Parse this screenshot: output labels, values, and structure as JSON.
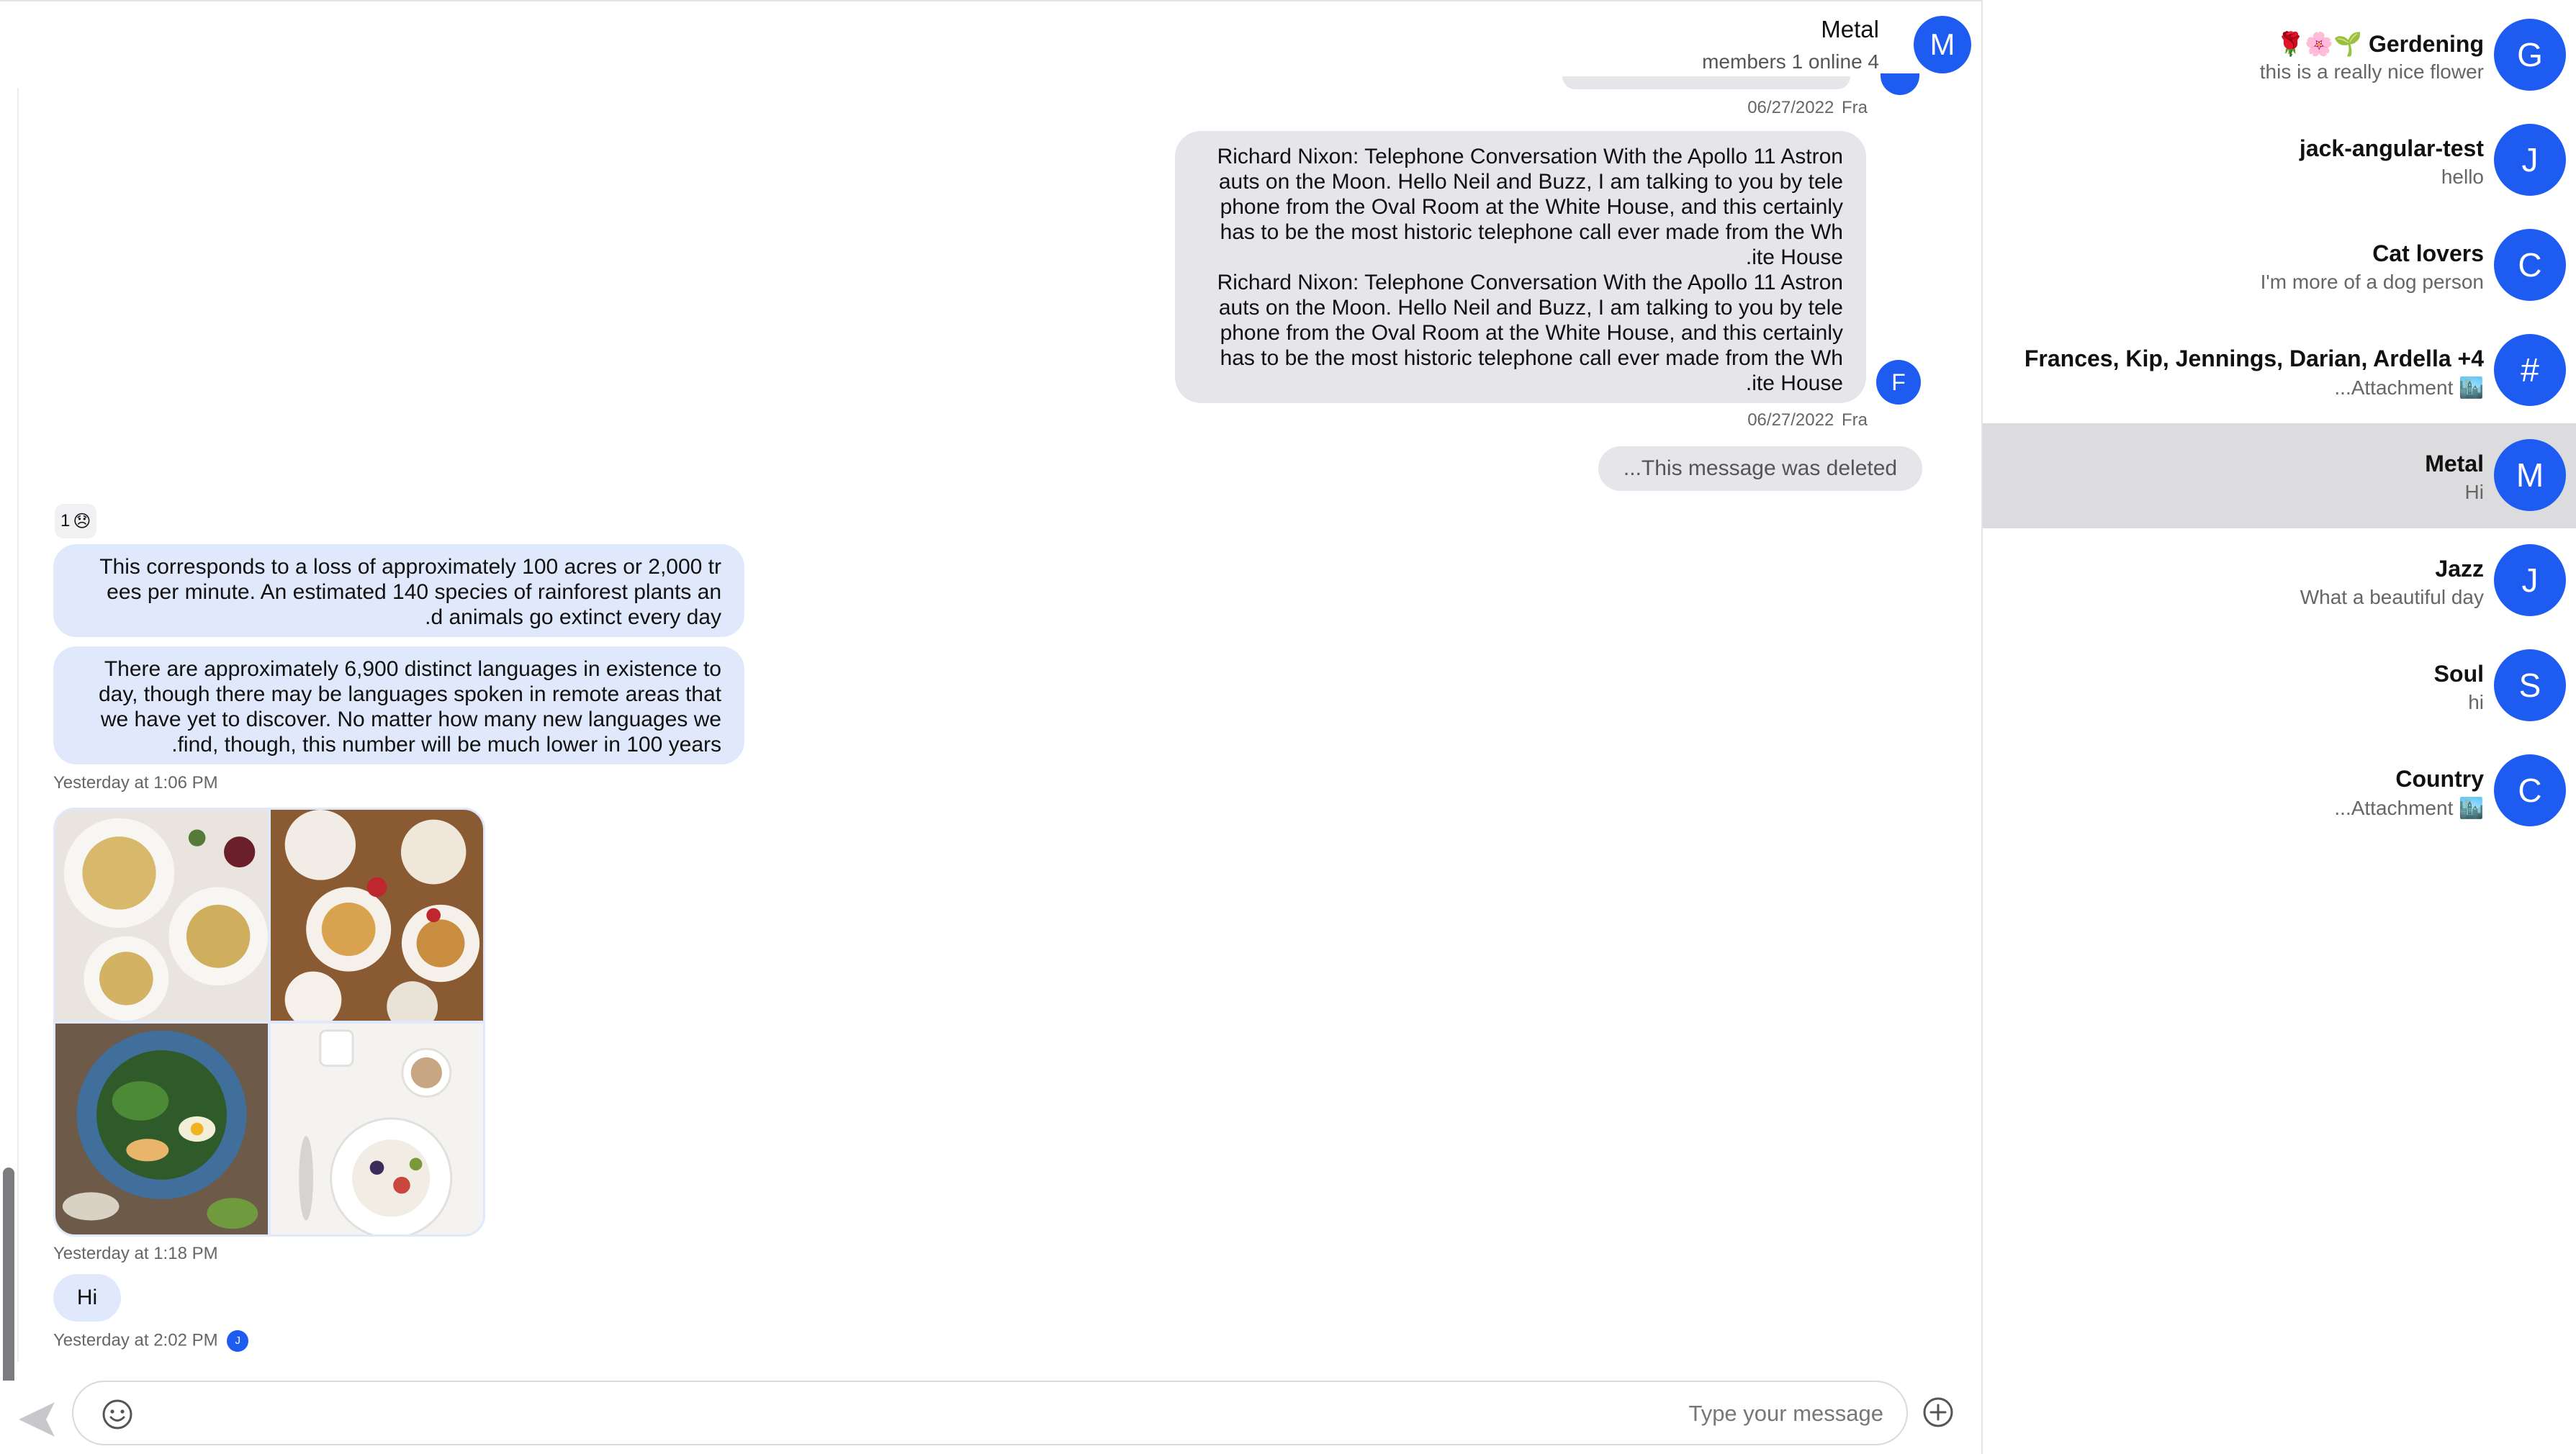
{
  "header": {
    "title": "Metal",
    "subtitle": "members 1 online 4",
    "avatar_letter": "M"
  },
  "messages": {
    "long_ts": "06/27/2022",
    "long_sender": "Fra",
    "top_ts": "06/27/2022",
    "top_sender": "Fra",
    "long_text_lines": [
      "Richard Nixon: Telephone Conversation With the Apollo 11 Astron",
      "auts on the Moon. Hello Neil and Buzz, I am talking to you by tele",
      "phone from the Oval Room at the White House, and this certainly",
      "has to be the most historic telephone call ever made from the Wh",
      ".ite House",
      "Richard Nixon: Telephone Conversation With the Apollo 11 Astron",
      "auts on the Moon. Hello Neil and Buzz, I am talking to you by tele",
      "phone from the Oval Room at the White House, and this certainly",
      "has to be the most historic telephone call ever made from the Wh",
      ".ite House"
    ],
    "long_avatar_letter": "F",
    "deleted_text": "...This message was deleted",
    "reaction_count": "1",
    "reaction_emoji": "😞",
    "rain_lines": [
      "This corresponds to a loss of approximately 100 acres or 2,000 tr",
      "ees per minute. An estimated 140 species of rainforest plants an",
      ".d animals go extinct every day"
    ],
    "lang_lines": [
      "There are approximately 6,900 distinct languages in existence to",
      "day, though there may be languages spoken in remote areas that",
      "we have yet to discover. No matter how many new languages we",
      ".find, though, this number will be much lower in 100 years"
    ],
    "ts_1": "Yesterday at 1:06 PM",
    "ts_2": "Yesterday at 1:18 PM",
    "hi_text": "Hi",
    "ts_3": "Yesterday at 2:02 PM",
    "read_letter": "J"
  },
  "composer": {
    "placeholder": "Type your message"
  },
  "sidebar": {
    "conversations": [
      {
        "avatar": "G",
        "name": "🌹🌸🌱 Gerdening",
        "last": "this is a really nice flower",
        "active": false
      },
      {
        "avatar": "J",
        "name": "jack-angular-test",
        "last": "hello",
        "active": false
      },
      {
        "avatar": "C",
        "name": "Cat lovers",
        "last": "I'm more of a dog person",
        "active": false
      },
      {
        "avatar": "#",
        "name": "Frances, Kip, Jennings, Darian, Ardella +4",
        "last": "...Attachment 🏙️",
        "active": false
      },
      {
        "avatar": "M",
        "name": "Metal",
        "last": "Hi",
        "active": true
      },
      {
        "avatar": "J",
        "name": "Jazz",
        "last": "What a beautiful day",
        "active": false
      },
      {
        "avatar": "S",
        "name": "Soul",
        "last": "hi",
        "active": false
      },
      {
        "avatar": "C",
        "name": "Country",
        "last": "...Attachment 🏙️",
        "active": false
      }
    ]
  },
  "colors": {
    "accent": "#1e5bf0",
    "bubble_grey": "#e6e6ea",
    "bubble_blue": "#dfe9fb",
    "active_row": "#dcdcdf"
  }
}
